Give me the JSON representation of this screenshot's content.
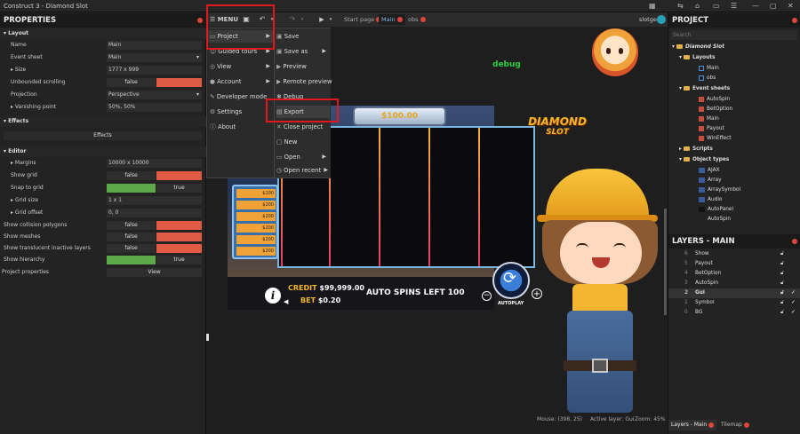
{
  "app": {
    "title": "Construct 3 - Diamond Slot"
  },
  "toolbar": {
    "menu_label": "MENU",
    "tabs": [
      {
        "label": "Start page"
      },
      {
        "label": "Main"
      },
      {
        "label": "obs"
      }
    ],
    "user": "slotgen"
  },
  "properties": {
    "header": "PROPERTIES",
    "sections": {
      "layout": "Layout",
      "effects": "Effects",
      "editor": "Editor"
    },
    "rows": {
      "name": {
        "label": "Name",
        "value": "Main"
      },
      "event_sheet": {
        "label": "Event sheet",
        "value": "Main"
      },
      "size": {
        "label": "Size",
        "value": "1777 x 999"
      },
      "unbounded": {
        "label": "Unbounded scrolling",
        "value": "false"
      },
      "projection": {
        "label": "Projection",
        "value": "Perspective"
      },
      "vanishing": {
        "label": "Vanishing point",
        "value": "50%, 50%"
      },
      "effects_btn": "Effects",
      "margins": {
        "label": "Margins",
        "value": "10000 x 10000"
      },
      "show_grid": {
        "label": "Show grid",
        "value": "false"
      },
      "snap_grid": {
        "label": "Snap to grid",
        "value": "true"
      },
      "grid_size": {
        "label": "Grid size",
        "value": "1 x 1"
      },
      "grid_offset": {
        "label": "Grid offset",
        "value": "0, 0"
      },
      "collision": {
        "label": "Show collision polygons",
        "value": "false"
      },
      "meshes": {
        "label": "Show meshes",
        "value": "false"
      },
      "translucent": {
        "label": "Show translucent inactive layers",
        "value": "false"
      },
      "hierarchy": {
        "label": "Show hierarchy",
        "value": "true"
      },
      "project_props": {
        "label": "Project properties",
        "value": "View"
      }
    }
  },
  "menu": {
    "items": [
      {
        "label": "Project"
      },
      {
        "label": "Guided tours"
      },
      {
        "label": "View"
      },
      {
        "label": "Account"
      },
      {
        "label": "Developer mode"
      },
      {
        "label": "Settings"
      },
      {
        "label": "About"
      }
    ],
    "submenu": [
      {
        "label": "Save"
      },
      {
        "label": "Save as"
      },
      {
        "label": "Preview"
      },
      {
        "label": "Remote preview"
      },
      {
        "label": "Debug"
      },
      {
        "label": "Export"
      },
      {
        "label": "Close project"
      },
      {
        "label": "New"
      },
      {
        "label": "Open"
      },
      {
        "label": "Open recent"
      }
    ]
  },
  "canvas": {
    "debug_text": "debug",
    "top_value": "$100.00",
    "logo_line1": "DIAMOND",
    "logo_line2": "SLOT",
    "paytable": [
      "$100",
      "$200",
      "$200",
      "$200",
      "$200",
      "$200"
    ],
    "credit_label": "CREDIT",
    "credit_value": "$99,999.00",
    "bet_label": "BET",
    "bet_value": "$0.20",
    "autospins": "AUTO SPINS LEFT 100",
    "autoplay": "AUTOPLAY",
    "minus": "−",
    "plus": "+"
  },
  "status": {
    "mouse": "Mouse: (398, 25)",
    "layer": "Active layer: Gui",
    "zoom": "Zoom: 45%"
  },
  "project": {
    "header": "PROJECT",
    "search_placeholder": "Search",
    "root": "Diamond Slot",
    "folders": {
      "layouts": "Layouts",
      "event_sheets": "Event sheets",
      "scripts": "Scripts",
      "object_types": "Object types"
    },
    "layouts": [
      "Main",
      "obs"
    ],
    "event_sheets": [
      "AutoSpin",
      "BetOption",
      "Main",
      "Payout",
      "WinEffect"
    ],
    "object_types": [
      "AJAX",
      "Array",
      "ArraySymbol",
      "Audio",
      "AutoPanel",
      "AutoSpin"
    ]
  },
  "layers": {
    "header": "LAYERS - MAIN",
    "rows": [
      {
        "num": "6",
        "name": "Show"
      },
      {
        "num": "5",
        "name": "Payout"
      },
      {
        "num": "4",
        "name": "BetOption"
      },
      {
        "num": "3",
        "name": "AutoSpin"
      },
      {
        "num": "2",
        "name": "Gui"
      },
      {
        "num": "1",
        "name": "Symbol"
      },
      {
        "num": "0",
        "name": "BG"
      }
    ],
    "bottom_tabs": [
      "Layers - Main",
      "Tilemap"
    ]
  },
  "colors": {
    "accent_red": "#e0443a",
    "highlight_box": "#e0171b",
    "toggle_false": "#e05a44",
    "toggle_true": "#5fa84a",
    "debug_green": "#2ecc40"
  }
}
